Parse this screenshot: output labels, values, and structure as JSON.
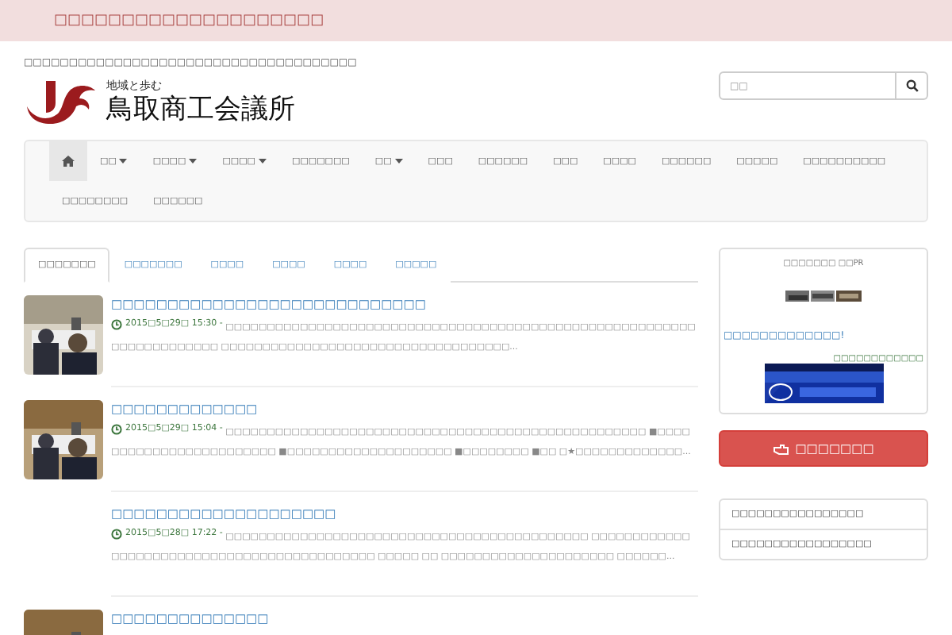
{
  "alert_banner": {
    "text": "□□□□□□□□□□□□□□□□□□□□"
  },
  "tagline": "□□□□□□□□□□□□□□□□□□□□□□□□□□□□□□□□□□□□□",
  "logo": {
    "subtitle": "地域と歩む",
    "title": "鳥取商工会議所"
  },
  "search": {
    "placeholder": "□□"
  },
  "nav": [
    {
      "kind": "home",
      "selected": true
    },
    {
      "label": "□□",
      "kind": "dropdown",
      "selected": false
    },
    {
      "label": "□□□□",
      "kind": "dropdown",
      "selected": false
    },
    {
      "label": "□□□□",
      "kind": "dropdown",
      "selected": false
    },
    {
      "label": "□□□□□□□",
      "kind": "link",
      "selected": false
    },
    {
      "label": "□□",
      "kind": "dropdown",
      "selected": false
    },
    {
      "label": "□□□",
      "kind": "link",
      "selected": false
    },
    {
      "label": "□□□□□□",
      "kind": "link",
      "selected": false
    },
    {
      "label": "□□□",
      "kind": "link",
      "selected": false
    },
    {
      "label": "□□□□",
      "kind": "link",
      "selected": false
    },
    {
      "label": "□□□□□□",
      "kind": "link",
      "selected": false
    },
    {
      "label": "□□□□□",
      "kind": "link",
      "selected": false
    },
    {
      "label": "□□□□□□□□□□",
      "kind": "link",
      "selected": false
    },
    {
      "label": "□□□□□□□□",
      "kind": "link",
      "selected": false
    },
    {
      "label": "□□□□□□",
      "kind": "link",
      "selected": false
    }
  ],
  "tabs": [
    {
      "label": "□□□□□□□",
      "selected": true
    },
    {
      "label": "□□□□□□□",
      "selected": false
    },
    {
      "label": "□□□□",
      "selected": false
    },
    {
      "label": "□□□□",
      "selected": false
    },
    {
      "label": "□□□□",
      "selected": false
    },
    {
      "label": "□□□□□",
      "selected": false
    }
  ],
  "posts": [
    {
      "title": "□□□□□□□□□□□□□□□□□□□□□□□□□□□□",
      "date": "2015□5□29□ 15:30 -",
      "excerpt": "□□□□□□□□□□□□□□□□□□□□□□□□□□□□□□□□□□□□□□□□□□□□□□□□□□□□□□□□□□□□□□□□□□□□□□ □□□□□□□□□□□□□□□□□□□□□□□□□□□□□□□□□□□...",
      "thumbnail": true
    },
    {
      "title": "□□□□□□□□□□□□□",
      "date": "2015□5□29□ 15:04 -",
      "excerpt": "□□□□□□□□□□□□□□□□□□□□□□□□□□□□□□□□□□□□□□□□□□□□□□□□□□□ ■□□□□□□□□□□□□□□□□□□□□□□□□ ■□□□□□□□□□□□□□□□□□□□□ ■□□□□□□□□ ■□□ □★□□□□□□□□□□□□□...",
      "thumbnail": true
    },
    {
      "title": "□□□□□□□□□□□□□□□□□□□□",
      "date": "2015□5□28□ 17:22 -",
      "excerpt": "□□□□□□□□□□□□□□□□□□□□□□□□□□□□□□□□□□□□□□□□□□□□ □□□□□□□□□□□□□□□□□□□□□□□□□□□□□□□□□□□□□□□□□□□□ □□□□□ □□ □□□□□□□□□□□□□□□□□□□□□ □□□□□□...",
      "thumbnail": false
    },
    {
      "title": "□□□□□□□□□□□□□□",
      "thumbnail": true
    }
  ],
  "sidebar": {
    "pr_title": "□□□□□□□ □□PR",
    "pr_link": "□□□□□□□□□□□□□!",
    "pr_note": "□□□□□□□□□□□□",
    "button": "□□□□□□□",
    "links": [
      "□□□□□□□□□□□□□□□□",
      "□□□□□□□□□□□□□□□□□"
    ]
  }
}
